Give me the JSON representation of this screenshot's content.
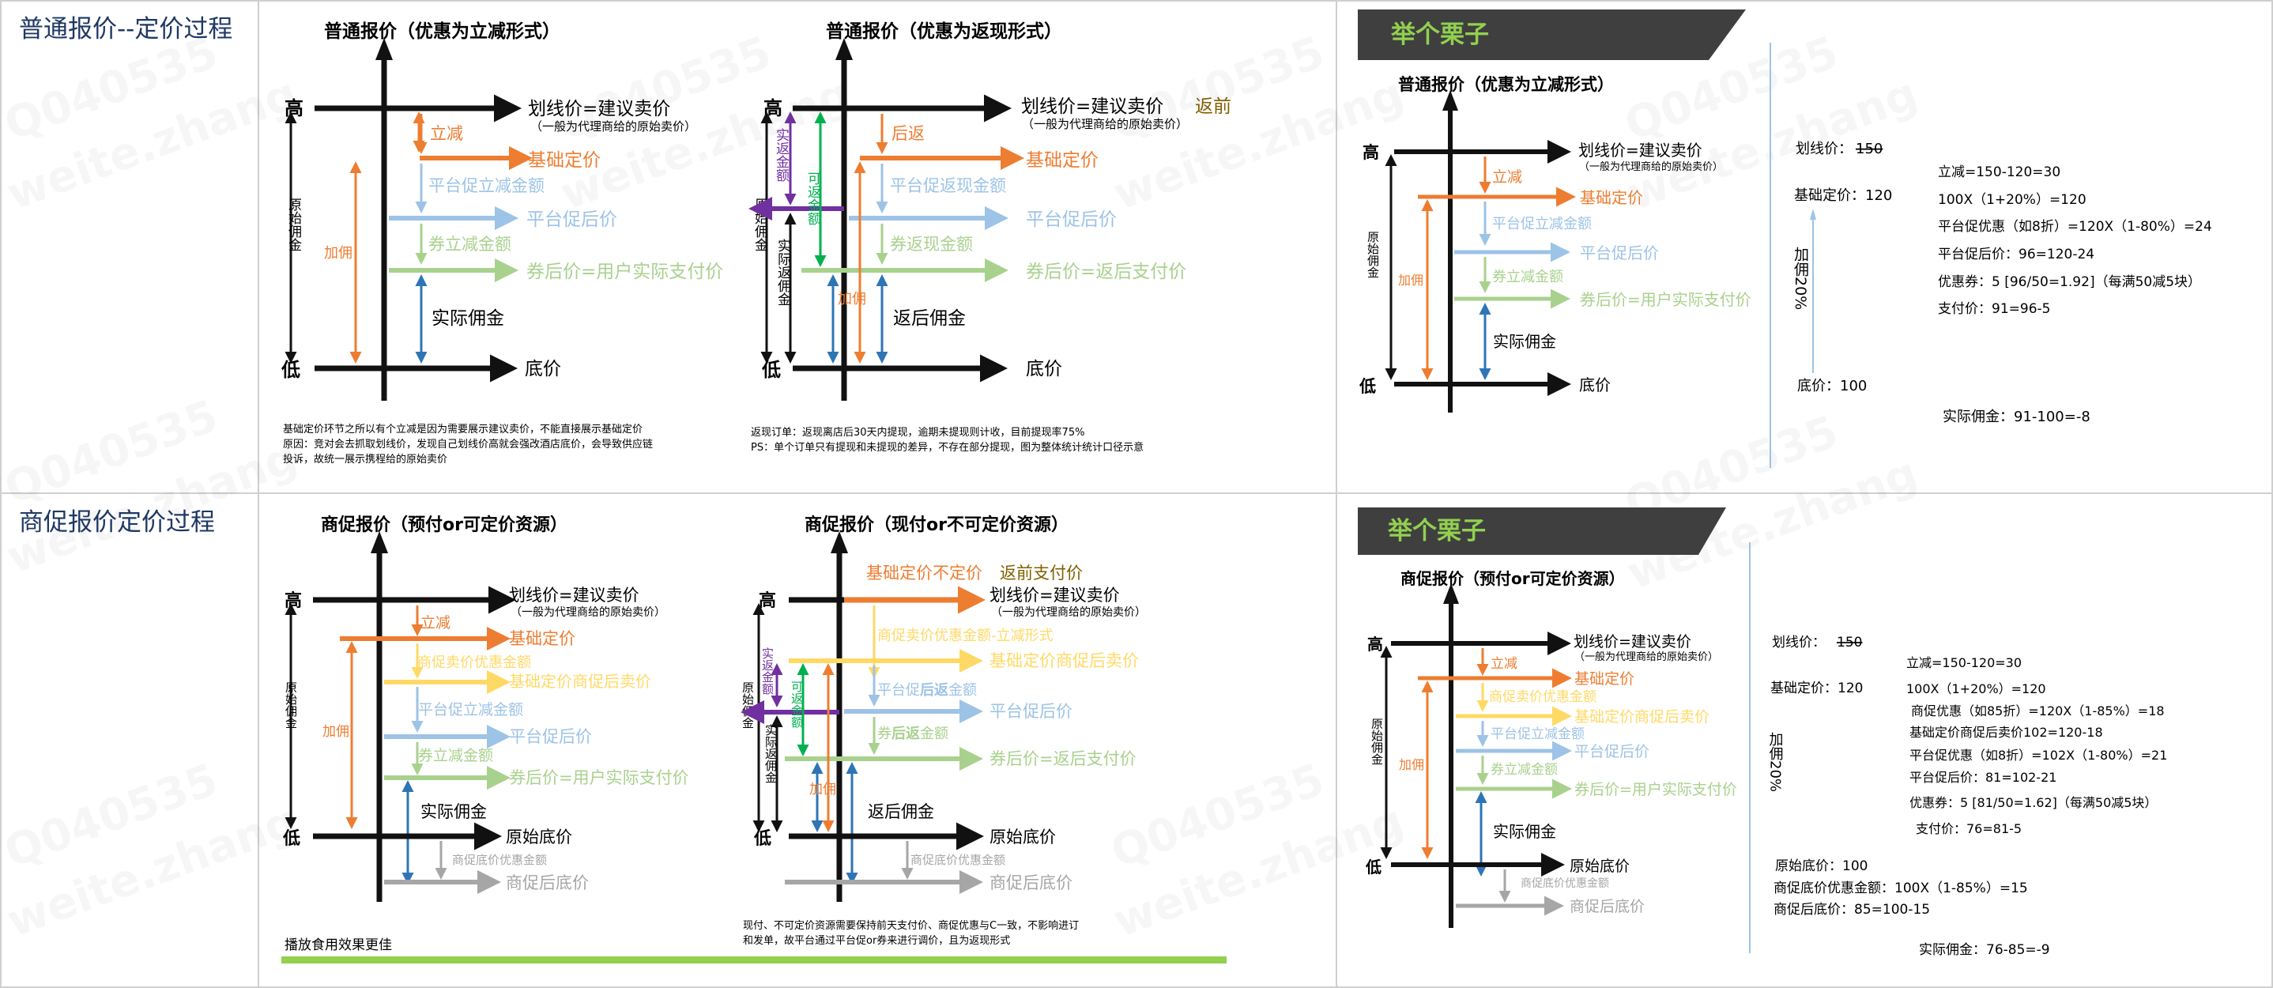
{
  "colors": {
    "black": "#111111",
    "orange": "#ed7d31",
    "blue": "#9dc3e6",
    "blue_dark": "#2e75b6",
    "green": "#a9d18e",
    "green_dark": "#00b050",
    "purple": "#7030a0",
    "yellow": "#ffd966",
    "gray": "#a6a6a6",
    "brown": "#806000",
    "lime": "#92d050",
    "banner": "#3f3f3f"
  },
  "watermark": [
    "Q040535",
    "weite.zhang"
  ],
  "section1": {
    "title": "普通报价--定价过程",
    "diagram_a": {
      "title": "普通报价（优惠为立减形式）",
      "high": "高",
      "low": "低",
      "line_top": "划线价=建议卖价",
      "line_top_sub": "（一般为代理商给的原始卖价）",
      "discount": "立减",
      "base_price": "基础定价",
      "platform_amount": "平台促立减金额",
      "platform_price": "平台促后价",
      "coupon_amount": "券立减金额",
      "after_coupon": "券后价=用户实际支付价",
      "original_commission": "原始佣金",
      "markup": "加佣",
      "actual_commission": "实际佣金",
      "floor": "底价",
      "note": [
        "基础定价环节之所以有个立减是因为需要展示建议卖价，不能直接展示基础定价",
        "原因：竞对会去抓取划线价，发现自己划线价高就会强改酒店底价，会导致供应链",
        "投诉，故统一展示携程给的原始卖价"
      ]
    },
    "diagram_b": {
      "title": "普通报价（优惠为返现形式）",
      "high": "高",
      "low": "低",
      "line_top": "划线价=建议卖价",
      "line_top_extra": "返前",
      "line_top_sub": "（一般为代理商给的原始卖价）",
      "cashback": "后返",
      "base_price": "基础定价",
      "platform_amount": "平台促返现金额",
      "platform_price": "平台促后价",
      "coupon_amount": "券返现金额",
      "after_coupon": "券后价=返后支付价",
      "original_commission": "原始佣金",
      "actual_return": "实返金额",
      "can_return": "可返金额",
      "actual_return_commission": "实际返佣金",
      "markup": "加佣",
      "after_return_commission": "返后佣金",
      "floor": "底价",
      "note": [
        "返现订单：返现离店后30天内提现，逾期未提现则计收，目前提现率75%",
        "PS：单个订单只有提现和未提现的差异，不存在部分提现，图为整体统计统计口径示意"
      ]
    },
    "example": {
      "banner": "举个栗子",
      "title": "普通报价（优惠为立减形式）",
      "high": "高",
      "low": "低",
      "line_top": "划线价=建议卖价",
      "line_top_sub": "（一般为代理商给的原始卖价）",
      "discount": "立减",
      "base_price": "基础定价",
      "platform_amount": "平台促立减金额",
      "platform_price": "平台促后价",
      "coupon_amount": "券立减金额",
      "after_coupon": "券后价=用户实际支付价",
      "original_commission": "原始佣金",
      "markup": "加佣",
      "actual_commission": "实际佣金",
      "floor": "底价",
      "list_price_label": "划线价：",
      "list_price_value": "150",
      "base_label": "基础定价：120",
      "markup_pct": "加佣20%",
      "floor_label": "底价：100",
      "calc": [
        "立减=150-120=30",
        "100X（1+20%）=120",
        "平台促优惠（如8折）=120X（1-80%）=24",
        "平台促后价：96=120-24",
        "优惠券：5 [96/50=1.92]（每满50减5块）",
        "支付价：91=96-5"
      ],
      "result": "实际佣金：91-100=-8"
    }
  },
  "section2": {
    "title": "商促报价定价过程",
    "diagram_a": {
      "title": "商促报价（预付or可定价资源）",
      "high": "高",
      "low": "低",
      "line_top": "划线价=建议卖价",
      "line_top_sub": "（一般为代理商给的原始卖价）",
      "discount": "立减",
      "base_price": "基础定价",
      "merchant_amount": "商促卖价优惠金额",
      "merchant_price": "基础定价商促后卖价",
      "platform_amount": "平台促立减金额",
      "platform_price": "平台促后价",
      "coupon_amount": "券立减金额",
      "after_coupon": "券后价=用户实际支付价",
      "original_commission": "原始佣金",
      "markup": "加佣",
      "actual_commission": "实际佣金",
      "floor": "原始底价",
      "floor_discount": "商促底价优惠金额",
      "floor_after": "商促后底价",
      "note": "播放食用效果更佳"
    },
    "diagram_b": {
      "title": "商促报价（现付or不可定价资源）",
      "high": "高",
      "low": "低",
      "header_left": "基础定价不定价",
      "header_right": "返前支付价",
      "line_top": "划线价=建议卖价",
      "line_top_sub": "（一般为代理商给的原始卖价）",
      "merchant_amount": "商促卖价优惠金额-立减形式",
      "merchant_price": "基础定价商促后卖价",
      "platform_amount_a": "平台促",
      "platform_amount_b": "后返",
      "platform_amount_c": "金额",
      "platform_price": "平台促后价",
      "coupon_amount_a": "券",
      "coupon_amount_b": "后返",
      "coupon_amount_c": "金额",
      "after_coupon": "券后价=返后支付价",
      "original_commission": "原始佣金",
      "actual_return": "实返金额",
      "can_return": "可返金额",
      "actual_return_commission": "实际返佣金",
      "markup": "加佣",
      "after_return_commission": "返后佣金",
      "floor": "原始底价",
      "floor_discount": "商促底价优惠金额",
      "floor_after": "商促后底价",
      "note": [
        "现付、不可定价资源需要保持前天支付价、商促优惠与C一致，不影响进订",
        "和发单，故平台通过平台促or券来进行调价，且为返现形式"
      ]
    },
    "example": {
      "banner": "举个栗子",
      "title": "商促报价（预付or可定价资源）",
      "high": "高",
      "low": "低",
      "line_top": "划线价=建议卖价",
      "line_top_sub": "（一般为代理商给的原始卖价）",
      "discount": "立减",
      "base_price": "基础定价",
      "merchant_amount": "商促卖价优惠金额",
      "merchant_price": "基础定价商促后卖价",
      "platform_amount": "平台促立减金额",
      "platform_price": "平台促后价",
      "coupon_amount": "券立减金额",
      "after_coupon": "券后价=用户实际支付价",
      "original_commission": "原始佣金",
      "markup": "加佣",
      "actual_commission": "实际佣金",
      "floor": "原始底价",
      "floor_discount": "商促底价优惠金额",
      "floor_after": "商促后底价",
      "list_price_label": "划线价：",
      "list_price_value": "150",
      "base_label": "基础定价：120",
      "markup_pct": "加佣20%",
      "calc": [
        "立减=150-120=30",
        "100X（1+20%）=120",
        "商促优惠（如85折）=120X（1-85%）=18",
        "基础定价商促后卖价102=120-18",
        "平台促优惠（如8折）=102X（1-80%）=21",
        "平台促后价：81=102-21",
        "优惠券：5 [81/50=1.62]（每满50减5块）",
        "支付价：76=81-5"
      ],
      "floor_label": "原始底价：100",
      "floor_discount_label": "商促底价优惠金额：100X（1-85%）=15",
      "floor_after_label": "商促后底价：85=100-15",
      "result": "实际佣金：76-85=-9"
    }
  }
}
